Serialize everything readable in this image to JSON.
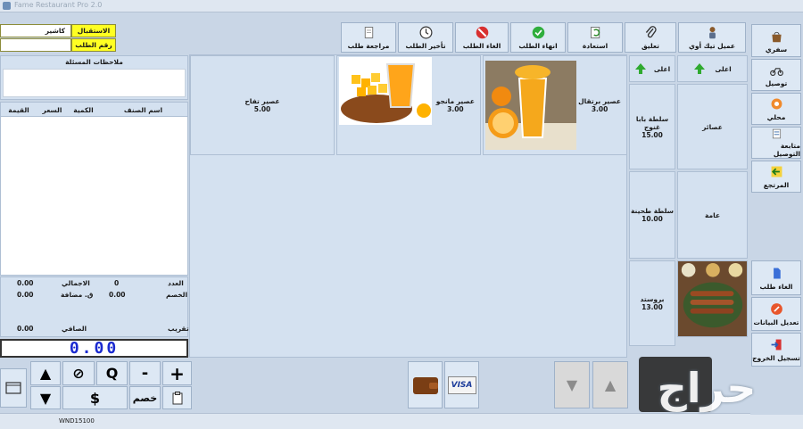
{
  "window": {
    "title": "Fame Restaurant Pro 2.0"
  },
  "info": {
    "cashier_label": "الاستقبال",
    "cashier_value": "كاشير",
    "order_no_label": "رقم الطلب",
    "order_no_value": ""
  },
  "order": {
    "notes_label": "ملاحظات المسئلة",
    "columns": [
      "اسم الصنف",
      "الكمية",
      "السعر",
      "القيمة"
    ]
  },
  "totals": {
    "count_label": "العدد",
    "count_value": "0",
    "total_label": "الاجمالي",
    "total_value": "0.00",
    "discount_label": "الخصم",
    "discount_value": "0.00",
    "added_label": "ق. مضافة",
    "added_value": "0.00",
    "round_label": "تقريب",
    "net_label": "الصافي",
    "net_value": "0.00",
    "display_value": "0.00"
  },
  "keypad": {
    "plus": "+",
    "minus": "-",
    "q": "Q",
    "cancel": "⊘",
    "up": "▲",
    "down": "▼",
    "discount": "خصم",
    "dollar": "$"
  },
  "status": {
    "machine": "WND15100"
  },
  "toolbar": [
    {
      "label": "عميل تيك أوي",
      "icon": "person-icon"
    },
    {
      "label": "تعليق",
      "icon": "paperclip-icon"
    },
    {
      "label": "استعادة",
      "icon": "restore-icon"
    },
    {
      "label": "انهاء الطلب",
      "icon": "check-icon"
    },
    {
      "label": "الغاء الطلب",
      "icon": "cancel-icon"
    },
    {
      "label": "تأخير الطلب",
      "icon": "clock-icon"
    },
    {
      "label": "مراجعة طلب",
      "icon": "review-icon"
    }
  ],
  "sidebar": [
    {
      "label": "سفري",
      "icon": "bag-icon"
    },
    {
      "label": "توصيل",
      "icon": "motorbike-icon"
    },
    {
      "label": "محلي",
      "icon": "dining-icon"
    },
    {
      "label": "متابعة التوصيل",
      "icon": "tracking-icon"
    },
    {
      "label": "المرتجع",
      "icon": "return-icon"
    },
    {
      "label": "الغاء طلب",
      "icon": "void-icon"
    },
    {
      "label": "تعديل البيانات",
      "icon": "edit-icon"
    },
    {
      "label": "تسجيل الخروج",
      "icon": "logout-icon"
    }
  ],
  "categories": {
    "up_label": "اعلى",
    "items": [
      "عصائر",
      "عامة"
    ]
  },
  "subcategories": {
    "up_label": "اعلى",
    "items": [
      {
        "name": "سلطة بابا غنوج",
        "price": "15.00"
      },
      {
        "name": "سلطة طحينة",
        "price": "10.00"
      },
      {
        "name": "بروستد",
        "price": "13.00"
      }
    ]
  },
  "products": [
    {
      "name": "عصير برتقال",
      "price": "3.00",
      "image": "orange-juice"
    },
    {
      "name": "عصير مانجو",
      "price": "3.00",
      "image": "mango-juice"
    },
    {
      "name": "عصير تفاح",
      "price": "5.00",
      "image": ""
    }
  ],
  "payment": {
    "card_label": "VISA"
  },
  "watermark": {
    "text": "حراج"
  },
  "colors": {
    "accent_yellow": "#ffff22",
    "panel": "#d4e1f0",
    "display_blue": "#1a2ad0"
  }
}
